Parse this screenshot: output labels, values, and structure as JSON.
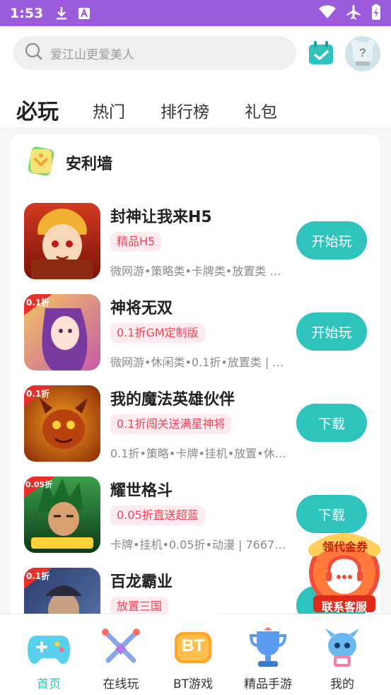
{
  "status_bar": {
    "time": "1:53",
    "icons": [
      "download-icon",
      "text-a-icon",
      "wifi-icon",
      "airplane-icon",
      "battery-icon"
    ]
  },
  "search": {
    "placeholder": "爱江山更爱美人"
  },
  "tabs": [
    {
      "label": "必玩",
      "active": true
    },
    {
      "label": "热门",
      "active": false
    },
    {
      "label": "排行榜",
      "active": false
    },
    {
      "label": "礼包",
      "active": false
    }
  ],
  "section": {
    "title": "安利墙"
  },
  "games": [
    {
      "name": "封神让我来H5",
      "tag": "精品H5",
      "meta": "微网游•策略类•卡牌类•放置类 …",
      "button": "开始玩"
    },
    {
      "name": "神将无双",
      "tag": "0.1折GM定制版",
      "meta": "微网游•休闲类•0.1折•放置类 | …",
      "button": "开始玩"
    },
    {
      "name": "我的魔法英雄伙伴",
      "tag": "0.1折闯关送满星神将",
      "meta": "0.1折•策略•卡牌•挂机•放置•休…",
      "button": "下载"
    },
    {
      "name": "耀世格斗",
      "tag": "0.05折直送超蓝",
      "meta": "卡牌•挂机•0.05折•动漫 | 7667…",
      "button": "下载"
    },
    {
      "name": "百龙霸业",
      "tag": "放置三国",
      "meta": "",
      "button": ""
    }
  ],
  "thumb_badges": [
    "0.1折",
    "0.1折",
    "0.05折",
    "0.1折"
  ],
  "float_service": {
    "top_text": "领代金券",
    "bottom_text": "联系客服"
  },
  "bottom_nav": [
    {
      "label": "首页",
      "icon": "gamepad-icon",
      "active": true
    },
    {
      "label": "在线玩",
      "icon": "crossed-swords-icon",
      "active": false
    },
    {
      "label": "BT游戏",
      "icon": "bt-badge-icon",
      "active": false,
      "icon_text": "BT"
    },
    {
      "label": "精品手游",
      "icon": "trophy-icon",
      "active": false
    },
    {
      "label": "我的",
      "icon": "robot-mascot-icon",
      "active": false
    }
  ],
  "colors": {
    "status_bar": "#9b5bdc",
    "accent": "#2ec4bd",
    "tag_text": "#f0455a",
    "tag_bg": "#fdebed"
  }
}
